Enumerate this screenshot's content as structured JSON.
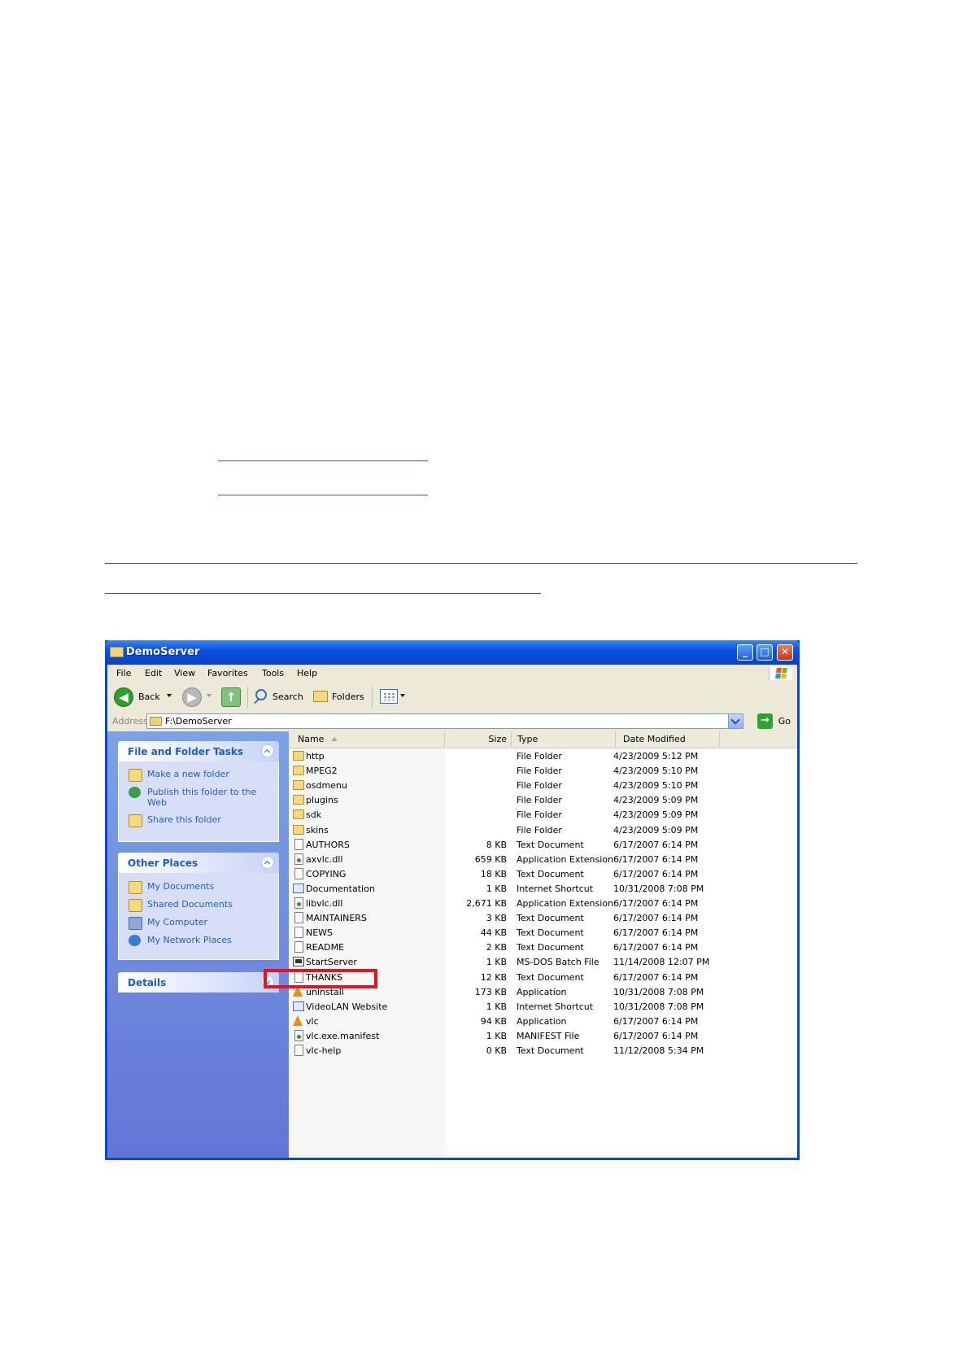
{
  "window": {
    "title": "DemoServer",
    "menu": [
      "File",
      "Edit",
      "View",
      "Favorites",
      "Tools",
      "Help"
    ],
    "toolbar": {
      "back": "Back",
      "search": "Search",
      "folders": "Folders"
    },
    "address": {
      "label": "Address",
      "value": "F:\\DemoServer",
      "go": "Go"
    },
    "tasks_panel": {
      "title": "File and Folder Tasks",
      "items": [
        {
          "label": "Make a new folder",
          "icon": "new-folder-icon"
        },
        {
          "label": "Publish this folder to the Web",
          "icon": "publish-web-icon"
        },
        {
          "label": "Share this folder",
          "icon": "share-folder-icon"
        }
      ]
    },
    "places_panel": {
      "title": "Other Places",
      "items": [
        {
          "label": "My Documents",
          "icon": "my-documents-icon"
        },
        {
          "label": "Shared Documents",
          "icon": "shared-documents-icon"
        },
        {
          "label": "My Computer",
          "icon": "my-computer-icon"
        },
        {
          "label": "My Network Places",
          "icon": "network-places-icon"
        }
      ]
    },
    "details_panel": {
      "title": "Details"
    },
    "columns": {
      "name": "Name",
      "size": "Size",
      "type": "Type",
      "date": "Date Modified"
    },
    "files": [
      {
        "name": "http",
        "size": "",
        "type": "File Folder",
        "date": "4/23/2009 5:12 PM",
        "icon": "folder"
      },
      {
        "name": "MPEG2",
        "size": "",
        "type": "File Folder",
        "date": "4/23/2009 5:10 PM",
        "icon": "folder"
      },
      {
        "name": "osdmenu",
        "size": "",
        "type": "File Folder",
        "date": "4/23/2009 5:10 PM",
        "icon": "folder"
      },
      {
        "name": "plugins",
        "size": "",
        "type": "File Folder",
        "date": "4/23/2009 5:09 PM",
        "icon": "folder"
      },
      {
        "name": "sdk",
        "size": "",
        "type": "File Folder",
        "date": "4/23/2009 5:09 PM",
        "icon": "folder"
      },
      {
        "name": "skins",
        "size": "",
        "type": "File Folder",
        "date": "4/23/2009 5:09 PM",
        "icon": "folder"
      },
      {
        "name": "AUTHORS",
        "size": "8 KB",
        "type": "Text Document",
        "date": "6/17/2007 6:14 PM",
        "icon": "doc"
      },
      {
        "name": "axvlc.dll",
        "size": "659 KB",
        "type": "Application Extension",
        "date": "6/17/2007 6:14 PM",
        "icon": "dll"
      },
      {
        "name": "COPYING",
        "size": "18 KB",
        "type": "Text Document",
        "date": "6/17/2007 6:14 PM",
        "icon": "doc"
      },
      {
        "name": "Documentation",
        "size": "1 KB",
        "type": "Internet Shortcut",
        "date": "10/31/2008 7:08 PM",
        "icon": "link"
      },
      {
        "name": "libvlc.dll",
        "size": "2,671 KB",
        "type": "Application Extension",
        "date": "6/17/2007 6:14 PM",
        "icon": "dll"
      },
      {
        "name": "MAINTAINERS",
        "size": "3 KB",
        "type": "Text Document",
        "date": "6/17/2007 6:14 PM",
        "icon": "doc"
      },
      {
        "name": "NEWS",
        "size": "44 KB",
        "type": "Text Document",
        "date": "6/17/2007 6:14 PM",
        "icon": "doc"
      },
      {
        "name": "README",
        "size": "2 KB",
        "type": "Text Document",
        "date": "6/17/2007 6:14 PM",
        "icon": "doc"
      },
      {
        "name": "StartServer",
        "size": "1 KB",
        "type": "MS-DOS Batch File",
        "date": "11/14/2008 12:07 PM",
        "icon": "bat"
      },
      {
        "name": "THANKS",
        "size": "12 KB",
        "type": "Text Document",
        "date": "6/17/2007 6:14 PM",
        "icon": "doc"
      },
      {
        "name": "uninstall",
        "size": "173 KB",
        "type": "Application",
        "date": "10/31/2008 7:08 PM",
        "icon": "cone"
      },
      {
        "name": "VideoLAN Website",
        "size": "1 KB",
        "type": "Internet Shortcut",
        "date": "10/31/2008 7:08 PM",
        "icon": "link"
      },
      {
        "name": "vlc",
        "size": "94 KB",
        "type": "Application",
        "date": "6/17/2007 6:14 PM",
        "icon": "cone"
      },
      {
        "name": "vlc.exe.manifest",
        "size": "1 KB",
        "type": "MANIFEST File",
        "date": "6/17/2007 6:14 PM",
        "icon": "dll"
      },
      {
        "name": "vlc-help",
        "size": "0 KB",
        "type": "Text Document",
        "date": "11/12/2008 5:34 PM",
        "icon": "doc"
      }
    ],
    "highlight_color": "#e8111c"
  }
}
